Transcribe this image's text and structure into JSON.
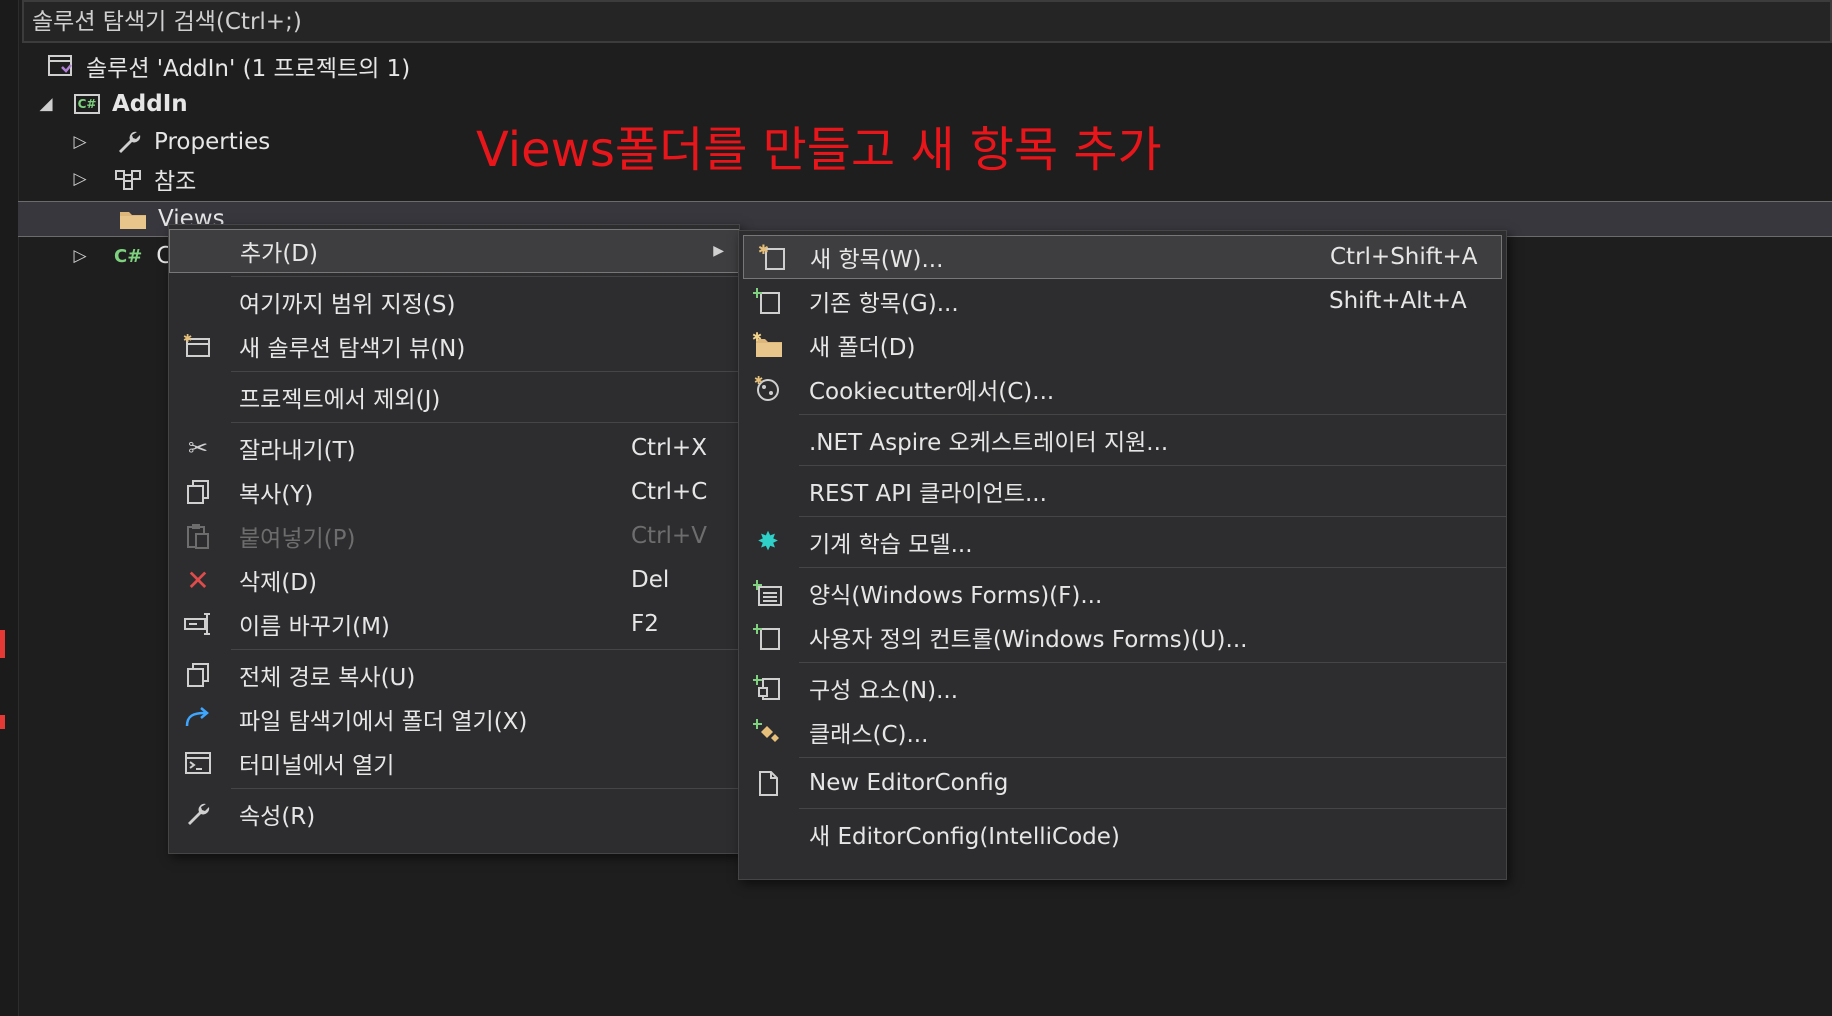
{
  "search": {
    "placeholder": "솔루션 탐색기 검색(Ctrl+;)"
  },
  "tree": {
    "solution": "솔루션 'AddIn' (1 프로젝트의 1)",
    "project": "AddIn",
    "properties": "Properties",
    "references": "참조",
    "views": "Views",
    "hidden_item": "C"
  },
  "annotation": "Views폴더를 만들고 새 항목 추가",
  "context_menu": {
    "items": [
      {
        "label": "추가(D)"
      },
      {
        "label": "여기까지 범위 지정(S)"
      },
      {
        "label": "새 솔루션 탐색기 뷰(N)"
      },
      {
        "label": "프로젝트에서 제외(J)"
      },
      {
        "label": "잘라내기(T)",
        "shortcut": "Ctrl+X"
      },
      {
        "label": "복사(Y)",
        "shortcut": "Ctrl+C"
      },
      {
        "label": "붙여넣기(P)",
        "shortcut": "Ctrl+V"
      },
      {
        "label": "삭제(D)",
        "shortcut": "Del"
      },
      {
        "label": "이름 바꾸기(M)",
        "shortcut": "F2"
      },
      {
        "label": "전체 경로 복사(U)"
      },
      {
        "label": "파일 탐색기에서 폴더 열기(X)"
      },
      {
        "label": "터미널에서 열기"
      },
      {
        "label": "속성(R)"
      }
    ]
  },
  "submenu": {
    "items": [
      {
        "label": "새 항목(W)...",
        "shortcut": "Ctrl+Shift+A"
      },
      {
        "label": "기존 항목(G)...",
        "shortcut": "Shift+Alt+A"
      },
      {
        "label": "새 폴더(D)"
      },
      {
        "label": "Cookiecutter에서(C)..."
      },
      {
        "label": ".NET Aspire 오케스트레이터 지원..."
      },
      {
        "label": "REST API 클라이언트..."
      },
      {
        "label": "기계 학습 모델..."
      },
      {
        "label": "양식(Windows Forms)(F)..."
      },
      {
        "label": "사용자 정의 컨트롤(Windows Forms)(U)..."
      },
      {
        "label": "구성 요소(N)..."
      },
      {
        "label": "클래스(C)..."
      },
      {
        "label": "New EditorConfig"
      },
      {
        "label": "새 EditorConfig(IntelliCode)"
      }
    ]
  },
  "colors": {
    "background": "#1e1e1e",
    "menu": "#2d2d30",
    "annotation": "#e8161b",
    "delete_icon": "#e04b4b",
    "accent_icon": "#3ea6ff",
    "ml_icon": "#2fd0c8"
  }
}
